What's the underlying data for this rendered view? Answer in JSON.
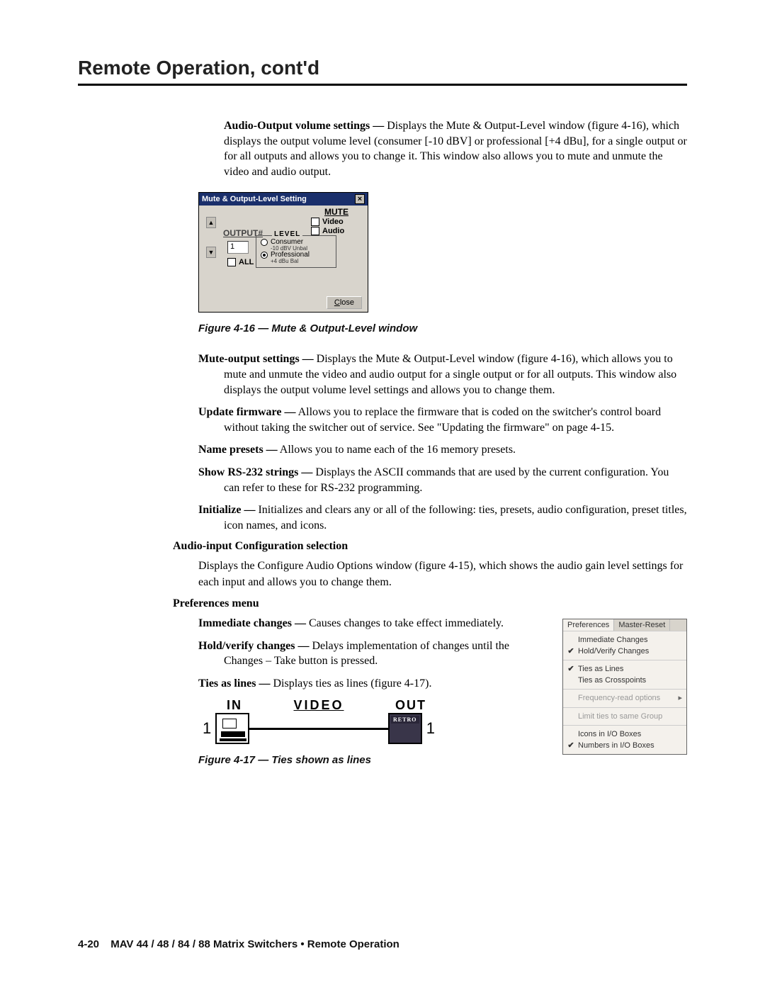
{
  "page_title": "Remote Operation, cont'd",
  "para_audio_output": {
    "term": "Audio-Output volume settings —",
    "body": " Displays the Mute & Output-Level window (figure 4-16), which displays the output volume level (consumer [-10 dBV] or professional [+4 dBu], for a single output or for all outputs and allows you to change it.  This window also allows you to mute and unmute the video and audio output."
  },
  "dialog416": {
    "title": "Mute & Output-Level Setting",
    "output_label": "OUTPUT#",
    "output_value": "1",
    "all_label": "ALL",
    "mute_header": "MUTE",
    "mute_video": "Video",
    "mute_audio": "Audio",
    "level_label": "LEVEL",
    "consumer": "Consumer",
    "consumer_sub": "-10 dBV Unbal",
    "pro": "Professional",
    "pro_sub": "+4 dBu Bal",
    "close": "Close"
  },
  "caption416": "Figure 4-16 — Mute & Output-Level window",
  "defs": {
    "mute": {
      "term": "Mute-output settings —",
      "body": " Displays the Mute & Output-Level window (figure 4-16), which allows you to mute and unmute the video and audio output for a single output or for all outputs.  This window also displays the output volume level settings and allows you to change them."
    },
    "update": {
      "term": "Update firmware —",
      "body": " Allows you to replace the firmware that is coded on the switcher's control board without taking the switcher out of service.  See \"Updating the firmware\" on page 4-15."
    },
    "name": {
      "term": "Name presets —",
      "body": " Allows you to name each of the 16 memory presets."
    },
    "show": {
      "term": "Show RS-232 strings —",
      "body": " Displays the ASCII commands that are used by the current configuration.  You can refer to these for RS-232 programming."
    },
    "init": {
      "term": "Initialize —",
      "body": " Initializes and clears any or all of the following: ties, presets, audio configuration, preset titles, icon names, and icons."
    }
  },
  "subhead_audio_input": "Audio-input Configuration selection",
  "audio_input_body": "Displays the Configure Audio Options window (figure 4-15), which shows the audio gain level settings for each input and allows you to change them.",
  "subhead_prefs": "Preferences menu",
  "prefs": {
    "immediate": {
      "term": "Immediate changes —",
      "body": " Causes changes to take effect immediately."
    },
    "hold": {
      "term": "Hold/verify changes —",
      "body": " Delays implementation of changes until the Changes – Take button is pressed."
    },
    "ties": {
      "term": "Ties as lines —",
      "body": " Displays ties as lines (figure 4-17)."
    }
  },
  "prefmenu": {
    "tab1": "Preferences",
    "tab2": "Master-Reset",
    "items": [
      {
        "chk": "",
        "label": "Immediate Changes",
        "disabled": false
      },
      {
        "chk": "✔",
        "label": "Hold/Verify Changes",
        "disabled": false
      }
    ],
    "items2": [
      {
        "chk": "✔",
        "label": "Ties as Lines",
        "disabled": false
      },
      {
        "chk": "",
        "label": "Ties as Crosspoints",
        "disabled": false
      }
    ],
    "items3": [
      {
        "chk": "",
        "label": "Frequency-read options",
        "disabled": true,
        "arrow": true
      }
    ],
    "items4": [
      {
        "chk": "",
        "label": "Limit ties to same Group",
        "disabled": true
      }
    ],
    "items5": [
      {
        "chk": "",
        "label": "Icons in I/O Boxes",
        "disabled": false
      },
      {
        "chk": "✔",
        "label": "Numbers in I/O Boxes",
        "disabled": false
      }
    ]
  },
  "diag417": {
    "in": "IN",
    "video": "VIDEO",
    "out": "OUT",
    "n1": "1",
    "n2": "1",
    "retro": "RETRO"
  },
  "caption417": "Figure 4-17 — Ties shown as lines",
  "footer": {
    "pageno": "4-20",
    "text": "MAV 44 / 48 / 84 / 88 Matrix Switchers • Remote Operation"
  }
}
